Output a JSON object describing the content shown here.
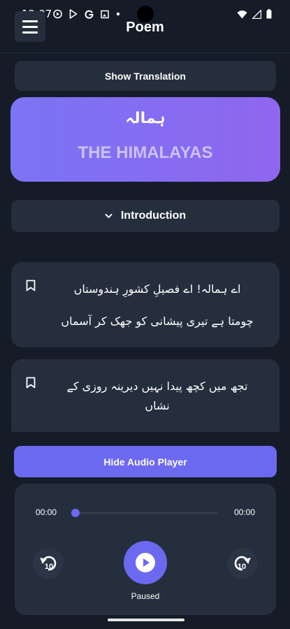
{
  "status_bar": {
    "time": "12:07",
    "left_icons": [
      "autoplay-icon",
      "play-store-icon",
      "google-icon",
      "photo-icon",
      "dot-icon"
    ],
    "right_icons": [
      "wifi-icon",
      "signal-icon",
      "battery-icon"
    ]
  },
  "header": {
    "title": "Poem",
    "menu_icon": "hamburger-icon"
  },
  "toolbar": {
    "translation_label": "Show Translation"
  },
  "hero": {
    "urdu_title": "ہمالہ",
    "english_title": "THE HIMALAYAS",
    "gradient": [
      "#7b74f5",
      "#8f66ef"
    ]
  },
  "intro": {
    "label": "Introduction",
    "icon": "chevron-down-icon"
  },
  "verses": [
    {
      "lines": [
        "اے ہمالہ! اے فصیلِ کشورِ ہندوستاں",
        "چومتا ہے تیری پیشانی کو جھک کر آسماں"
      ]
    },
    {
      "lines": [
        "تجھ میں کچھ پیدا نہیں دیرینہ روزی کے",
        "نشاں"
      ]
    }
  ],
  "player": {
    "toggle_label": "Hide Audio Player",
    "time_elapsed": "00:00",
    "time_total": "00:00",
    "progress": 0,
    "status": "Paused",
    "skip_back_label": "10",
    "skip_forward_label": "10",
    "accent": "#6c69f1"
  },
  "colors": {
    "background": "#151c28",
    "surface": "#252e3d",
    "accent": "#6c69f1"
  }
}
